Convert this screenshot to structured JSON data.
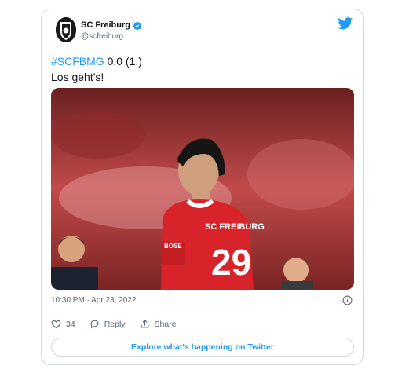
{
  "tweet": {
    "author_name": "SC Freiburg",
    "handle": "@scfreiburg",
    "hashtag": "#SCFBMG",
    "score_text": " 0:0 (1.)",
    "line2": "Los geht's!",
    "image_jersey_text": "SC FREIBURG",
    "image_jersey_number": "29",
    "image_sleeve_text": "BOSE",
    "timestamp": "10:30 PM · Apr 23, 2022"
  },
  "actions": {
    "likes": "34",
    "reply_label": "Reply",
    "share_label": "Share"
  },
  "explore_label": "Explore what's happening on Twitter",
  "colors": {
    "accent": "#1d9bf0",
    "verified": "#1d9bf0",
    "jersey_red": "#d8232a"
  },
  "icons": [
    "twitter-bird-icon",
    "verified-badge-icon",
    "info-icon",
    "heart-icon",
    "reply-icon",
    "share-icon"
  ]
}
